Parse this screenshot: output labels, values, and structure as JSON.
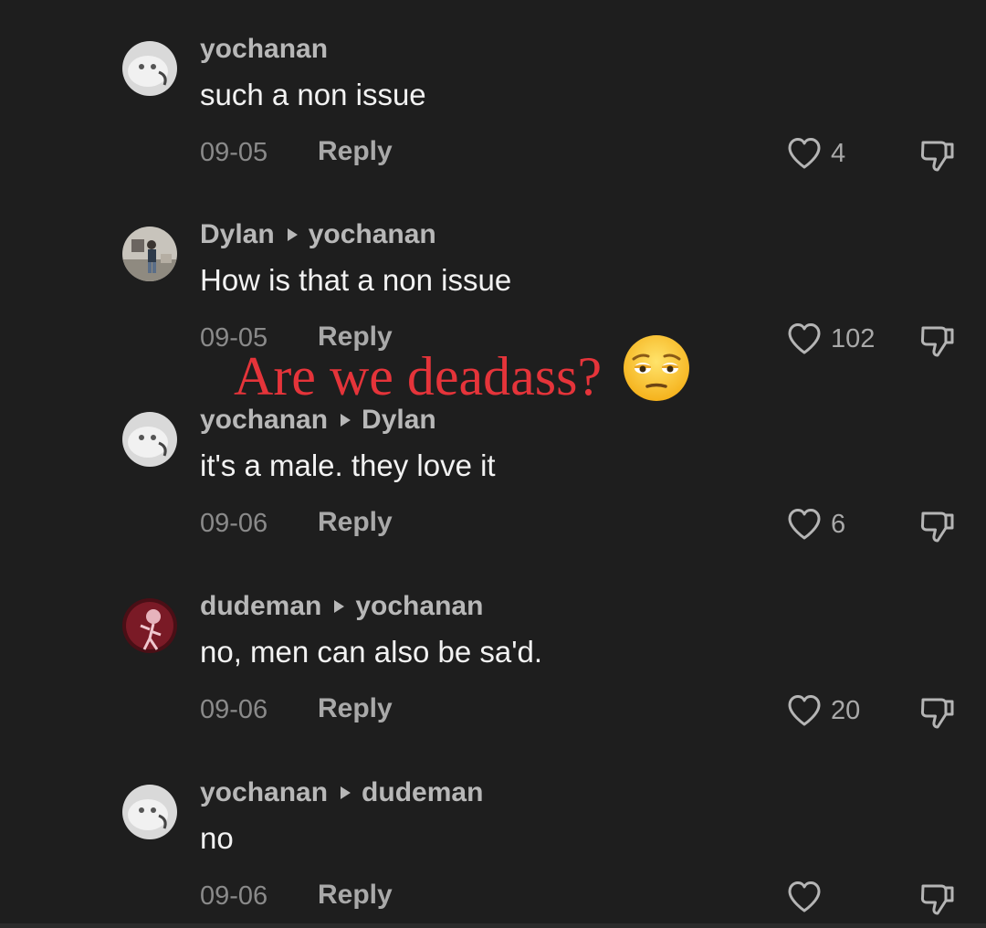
{
  "comments": [
    {
      "author": "yochanan",
      "reply_to": "",
      "text": "such a non issue",
      "date": "09-05",
      "reply_label": "Reply",
      "likes": "4",
      "avatar_icon": "grey-blob-avatar"
    },
    {
      "author": "Dylan",
      "reply_to": "yochanan",
      "text": "How is that a non issue",
      "date": "09-05",
      "reply_label": "Reply",
      "likes": "102",
      "avatar_icon": "photo-avatar"
    },
    {
      "author": "yochanan",
      "reply_to": "Dylan",
      "text": "it's a male. they love it",
      "date": "09-06",
      "reply_label": "Reply",
      "likes": "6",
      "avatar_icon": "grey-blob-avatar"
    },
    {
      "author": "dudeman",
      "reply_to": "yochanan",
      "text": "no, men can also be sa'd.",
      "date": "09-06",
      "reply_label": "Reply",
      "likes": "20",
      "avatar_icon": "red-skeleton-avatar"
    },
    {
      "author": "yochanan",
      "reply_to": "dudeman",
      "text": "no",
      "date": "09-06",
      "reply_label": "Reply",
      "likes": "",
      "avatar_icon": "grey-blob-avatar"
    }
  ],
  "overlay": {
    "text": "Are we deadass?",
    "emoji": "unamused-face-emoji",
    "color": "#e5343a"
  },
  "colors": {
    "background": "#1e1e1e",
    "username": "#b8b8b8",
    "comment_text": "#f2f2f2",
    "date": "#8a8a8a",
    "action": "#a9a9a9"
  }
}
